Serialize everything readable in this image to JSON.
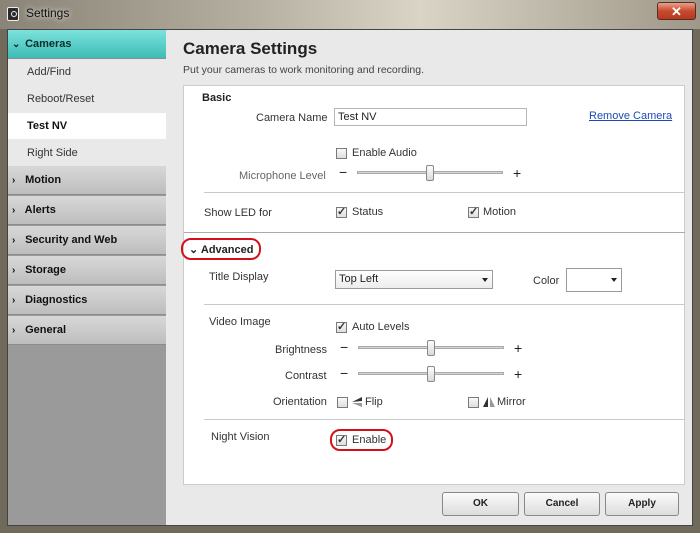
{
  "window": {
    "title": "Settings",
    "close_glyph": "✕"
  },
  "sidebar": {
    "categories": [
      {
        "label": "Cameras",
        "expanded": true
      },
      {
        "label": "Motion"
      },
      {
        "label": "Alerts"
      },
      {
        "label": "Security and Web"
      },
      {
        "label": "Storage"
      },
      {
        "label": "Diagnostics"
      },
      {
        "label": "General"
      }
    ],
    "camera_items": [
      "Add/Find",
      "Reboot/Reset",
      "Test NV",
      "Right Side"
    ],
    "selected_item": "Test NV"
  },
  "content": {
    "title": "Camera Settings",
    "subtitle": "Put your cameras to work monitoring and recording.",
    "basic": {
      "heading": "Basic",
      "camera_name_label": "Camera Name",
      "camera_name_value": "Test NV",
      "remove_camera": "Remove Camera",
      "enable_audio_label": "Enable Audio",
      "enable_audio_checked": false,
      "microphone_level_label": "Microphone Level",
      "microphone_level_fraction": 0.5,
      "show_led_label": "Show LED for",
      "led_status_label": "Status",
      "led_status_checked": true,
      "led_motion_label": "Motion",
      "led_motion_checked": true
    },
    "advanced": {
      "heading": "Advanced",
      "title_display_label": "Title Display",
      "title_display_value": "Top Left",
      "color_label": "Color",
      "color_value": "",
      "video_image_label": "Video Image",
      "auto_levels_label": "Auto Levels",
      "auto_levels_checked": true,
      "brightness_label": "Brightness",
      "brightness_fraction": 0.5,
      "contrast_label": "Contrast",
      "contrast_fraction": 0.5,
      "orientation_label": "Orientation",
      "flip_label": "Flip",
      "flip_checked": false,
      "mirror_label": "Mirror",
      "mirror_checked": false,
      "night_vision_label": "Night Vision",
      "night_vision_enable_label": "Enable",
      "night_vision_checked": true
    },
    "slider_minus": "−",
    "slider_plus": "+"
  },
  "buttons": {
    "ok": "OK",
    "cancel": "Cancel",
    "apply": "Apply"
  },
  "colors": {
    "accent_teal": "#3cbdb6",
    "highlight_red": "#d4111a",
    "link_blue": "#1d49b8"
  }
}
